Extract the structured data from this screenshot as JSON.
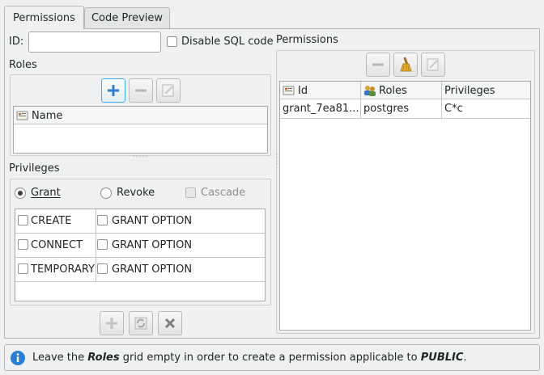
{
  "tabs": [
    {
      "label": "Permissions"
    },
    {
      "label": "Code Preview"
    }
  ],
  "left": {
    "id_label": "ID:",
    "id_value": "",
    "disable_sql_label": "Disable SQL code",
    "roles_label": "Roles",
    "roles_grid": {
      "columns": [
        "Name"
      ]
    },
    "privileges_label": "Privileges",
    "grant_label": "Grant",
    "revoke_label": "Revoke",
    "cascade_label": "Cascade",
    "privileges": [
      {
        "name": "CREATE",
        "option": "GRANT OPTION"
      },
      {
        "name": "CONNECT",
        "option": "GRANT OPTION"
      },
      {
        "name": "TEMPORARY",
        "option": "GRANT OPTION"
      }
    ]
  },
  "right": {
    "permissions_label": "Permissions",
    "grid": {
      "columns": [
        "Id",
        "Roles",
        "Privileges"
      ],
      "rows": [
        {
          "id": "grant_7ea81...",
          "roles": "postgres",
          "privileges": "C*c"
        }
      ]
    }
  },
  "info": {
    "text_before": "Leave the ",
    "text_roles": "Roles",
    "text_middle": " grid empty in order to create a permission applicable to ",
    "text_public": "PUBLIC",
    "text_end": "."
  },
  "colors": {
    "accent": "#3daee9",
    "add_icon": "#2f7fd0",
    "remove_icon": "#b7b9bb",
    "info_icon": "#2a7fd4"
  }
}
